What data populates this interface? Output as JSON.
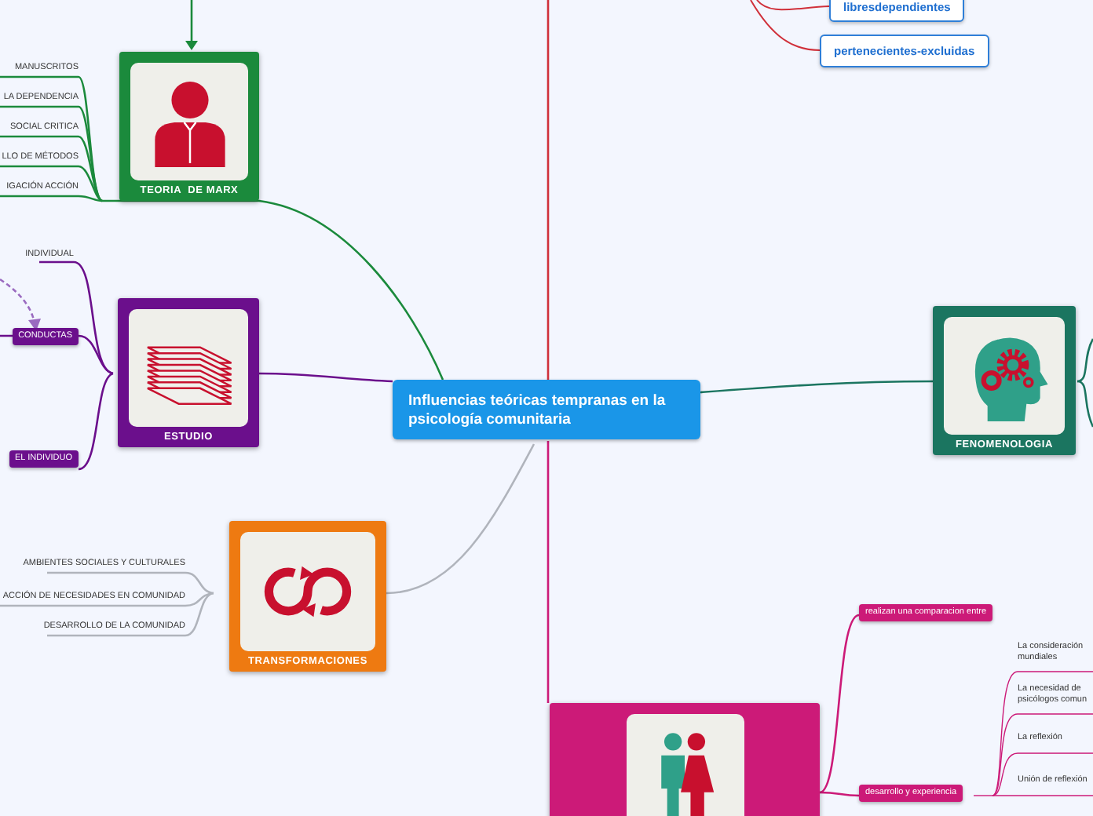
{
  "central_topic": "Influencias teóricas tempranas en la psicología comunitaria",
  "top_nodes": [
    "libresdependientes",
    "pertenecientes-excluidas"
  ],
  "branches": [
    {
      "kind": "person",
      "title": "TEORIA  DE MARX",
      "color": "#1b8a3c",
      "children": [
        {
          "label": "MANUSCRITOS",
          "kind": "plain"
        },
        {
          "label": "LA DEPENDENCIA",
          "kind": "plain"
        },
        {
          "label": "SOCIAL CRITICA",
          "kind": "plain"
        },
        {
          "label": "LLO DE MÉTODOS",
          "kind": "plain"
        },
        {
          "label": "IGACIÓN ACCIÓN",
          "kind": "plain"
        }
      ]
    },
    {
      "kind": "stack",
      "title": "ESTUDIO",
      "color": "#6b0f8c",
      "children": [
        {
          "label": "INDIVIDUAL",
          "kind": "plain"
        },
        {
          "label": "CONDUCTAS",
          "kind": "boxed"
        },
        {
          "label": "EL INDIVIDUO",
          "kind": "boxed"
        }
      ]
    },
    {
      "kind": "cycle",
      "title": "TRANSFORMACIONES",
      "color": "#ee7a11",
      "children": [
        {
          "label": "AMBIENTES SOCIALES Y CULTURALES",
          "kind": "plain"
        },
        {
          "label": "ACCIÓN DE NECESIDADES EN COMUNIDAD",
          "kind": "plain"
        },
        {
          "label": "DESARROLLO DE LA COMUNIDAD",
          "kind": "plain"
        }
      ]
    },
    {
      "kind": "head",
      "title": "FENOMENOLOGIA",
      "color": "#1b7560"
    },
    {
      "kind": "couple",
      "color": "#cc1a78",
      "children": [
        {
          "label": "realizan una comparacion entre",
          "kind": "boxed"
        },
        {
          "label": "desarrollo y experiencia",
          "kind": "boxed",
          "children": [
            {
              "lines": [
                "La consideración",
                "mundiales"
              ]
            },
            {
              "lines": [
                "La necesidad de",
                "psicólogos comun"
              ]
            },
            {
              "lines": [
                "La reflexión"
              ]
            },
            {
              "lines": [
                "Unión de reflexión"
              ]
            }
          ]
        }
      ]
    }
  ]
}
